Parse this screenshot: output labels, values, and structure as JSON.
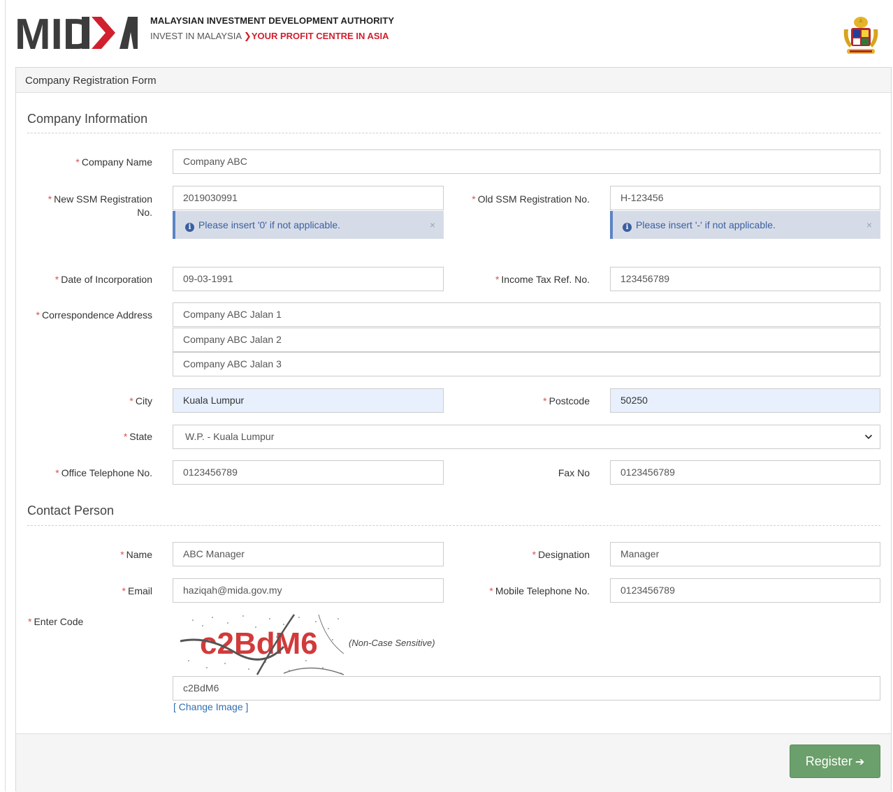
{
  "header": {
    "logo_text": "MIDA",
    "org_name": "MALAYSIAN INVESTMENT DEVELOPMENT AUTHORITY",
    "tagline_left": "INVEST IN MALAYSIA",
    "tagline_right": "YOUR PROFIT CENTRE IN ASIA",
    "crest_icon": "malaysia-coat-of-arms-icon",
    "brand_red": "#d0202e"
  },
  "form": {
    "title": "Company Registration Form",
    "required_marker": "*",
    "sections": {
      "company_info": "Company Information",
      "contact_person": "Contact Person"
    },
    "company": {
      "name_label": "Company Name",
      "name_value": "Company ABC",
      "new_ssm_label_line1": "New SSM Registration",
      "new_ssm_label_line2": "No.",
      "new_ssm_value": "2019030991",
      "new_ssm_note": "Please insert '0' if not applicable.",
      "old_ssm_label": "Old SSM Registration No.",
      "old_ssm_value": "H-123456",
      "old_ssm_note": "Please insert '-' if not applicable.",
      "doi_label": "Date of Incorporation",
      "doi_value": "09-03-1991",
      "tax_label": "Income Tax Ref. No.",
      "tax_value": "123456789",
      "address_label": "Correspondence Address",
      "address_lines": [
        "Company ABC Jalan 1",
        "Company ABC Jalan 2",
        "Company ABC Jalan 3"
      ],
      "city_label": "City",
      "city_value": "Kuala Lumpur",
      "postcode_label": "Postcode",
      "postcode_value": "50250",
      "state_label": "State",
      "state_value": "W.P. - Kuala Lumpur",
      "office_tel_label": "Office Telephone No.",
      "office_tel_value": "0123456789",
      "fax_label": "Fax No",
      "fax_value": "0123456789"
    },
    "contact": {
      "name_label": "Name",
      "name_value": "ABC Manager",
      "designation_label": "Designation",
      "designation_value": "Manager",
      "email_label": "Email",
      "email_value": "haziqah@mida.gov.my",
      "mobile_label": "Mobile Telephone No.",
      "mobile_value": "0123456789"
    },
    "captcha": {
      "label": "Enter Code",
      "image_text": "c2BdM6",
      "hint": "(Non-Case Sensitive)",
      "input_value": "c2BdM6",
      "change_link": "[ Change Image ]"
    },
    "register_label": "Register",
    "register_icon": "arrow-right-icon",
    "register_color": "#6b9f6b",
    "info_icon": "info-circle-icon",
    "close_icon": "close-icon",
    "select_icon": "chevron-down-icon"
  }
}
